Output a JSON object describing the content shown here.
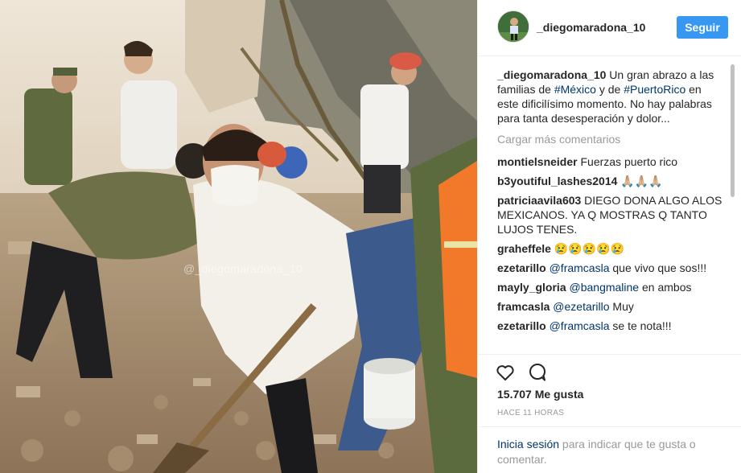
{
  "photo": {
    "watermark": "@_diegomaradona_10"
  },
  "header": {
    "username": "_diegomaradona_10",
    "follow_label": "Seguir"
  },
  "caption": {
    "username": "_diegomaradona_10",
    "text_1": " Un gran abrazo a las familias de ",
    "tag_1": "#México",
    "text_2": " y de ",
    "tag_2": "#PuertoRico",
    "text_3": " en este dificilísimo momento. No hay palabras para tanta desesperación y dolor..."
  },
  "load_more_label": "Cargar más comentarios",
  "comments": [
    {
      "user": "montielsneider",
      "mention": "",
      "text": " Fuerzas puerto rico"
    },
    {
      "user": "b3youtiful_lashes2014",
      "mention": "",
      "text": " 🙏🏼🙏🏼🙏🏼"
    },
    {
      "user": "patriciaavila603",
      "mention": "",
      "text": " DIEGO DONA ALGO ALOS MEXICANOS. YA Q MOSTRAS Q TANTO LUJOS TENES."
    },
    {
      "user": "graheffele",
      "mention": "",
      "text": " 😢😢😢😢😢"
    },
    {
      "user": "ezetarillo",
      "mention": " @framcasla",
      "text": " que vivo que sos!!!"
    },
    {
      "user": "mayly_gloria",
      "mention": " @bangmaline",
      "text": " en ambos"
    },
    {
      "user": "framcasla",
      "mention": " @ezetarillo",
      "text": " Muy"
    },
    {
      "user": "ezetarillo",
      "mention": " @framcasla",
      "text": " se te nota!!!"
    }
  ],
  "actions": {
    "like_icon": "heart-icon",
    "comment_icon": "comment-bubble-icon"
  },
  "likes": "15.707 Me gusta",
  "timestamp": "HACE 11 HORAS",
  "login": {
    "link": "Inicia sesión",
    "text": " para indicar que te gusta o comentar."
  },
  "colors": {
    "accent": "#3897f0",
    "link": "#003569",
    "muted": "#999999"
  }
}
